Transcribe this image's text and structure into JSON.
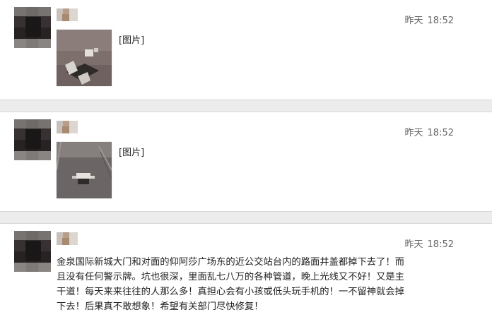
{
  "posts": [
    {
      "time_day": "昨天",
      "time_clock": "18:52",
      "image_label": "[图片]"
    },
    {
      "time_day": "昨天",
      "time_clock": "18:52",
      "image_label": "[图片]"
    },
    {
      "time_day": "昨天",
      "time_clock": "18:52",
      "text": "金泉国际新城大门和对面的仰阿莎广场东的近公交站台内的路面井盖都掉下去了！而且没有任何警示牌。坑也很深，里面乱七八万的各种管道，晚上光线又不好！又是主干道！每天来来往往的人那么多！真担心会有小孩或低头玩手机的！一不留神就会掉下去！后果真不敢想象！希望有关部门尽快修复！"
    }
  ],
  "colors": {
    "background": "#ececec",
    "card": "#ffffff",
    "meta_text": "#666666",
    "body_text": "#222222"
  }
}
